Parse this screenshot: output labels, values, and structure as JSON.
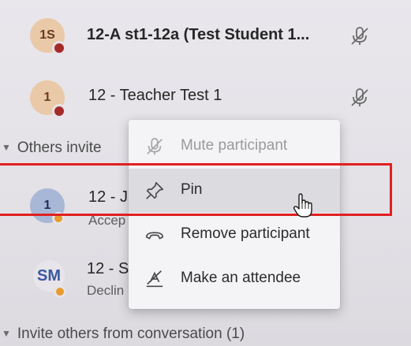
{
  "participants": [
    {
      "initials": "1S",
      "avatar_color": "#e9c9a8",
      "avatar_text_color": "#6b3b1f",
      "presence_color": "#a52a2a",
      "name": "12-A st1-12a (Test Student 1...",
      "mic_icon": "mic-muted-icon"
    },
    {
      "initials": "1",
      "avatar_color": "#e9c9a8",
      "avatar_text_color": "#6b3b1f",
      "presence_color": "#a52a2a",
      "name": "12 - Teacher Test 1",
      "mic_icon": "mic-muted-icon"
    }
  ],
  "others_invited": {
    "header": "Others invite",
    "items": [
      {
        "initials": "1",
        "avatar_color": "#a9b7d6",
        "avatar_text_color": "#1e2f5a",
        "presence_color": "#e89a2e",
        "name": "12 - J",
        "status": "Accep"
      },
      {
        "initials": "SM",
        "avatar_color": "#e7e4ea",
        "avatar_text_color": "#3a59a0",
        "presence_color": "#e89a2e",
        "name": "12 - S",
        "status": "Declin"
      }
    ]
  },
  "context_menu": {
    "items": [
      {
        "label": "Mute participant",
        "icon": "mic-muted-icon",
        "disabled": true
      },
      {
        "label": "Pin",
        "icon": "pin-icon",
        "disabled": false,
        "hover": true
      },
      {
        "label": "Remove participant",
        "icon": "hang-up-icon",
        "disabled": false
      },
      {
        "label": "Make an attendee",
        "icon": "make-attendee-icon",
        "disabled": false
      }
    ]
  },
  "invite_from_conversation": {
    "header": "Invite others from conversation (1)"
  },
  "colors": {
    "highlight": "#e02020",
    "background": "#e4e2e7",
    "menu_background": "#f4f3f6"
  }
}
